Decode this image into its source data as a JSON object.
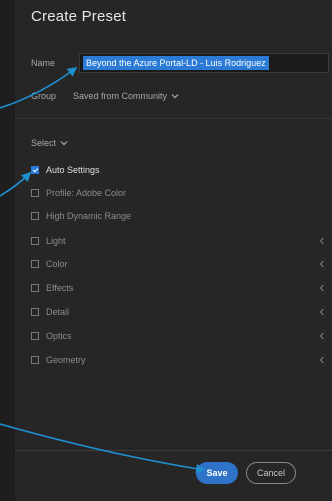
{
  "dialog": {
    "title": "Create Preset"
  },
  "name_field": {
    "label": "Name",
    "value": "Beyond the Azure Portal-LD - Luis Rodriguez"
  },
  "group_field": {
    "label": "Group",
    "value": "Saved from Community"
  },
  "select_menu": {
    "label": "Select"
  },
  "settings": [
    {
      "label": "Auto Settings",
      "checked": true,
      "expandable": false
    },
    {
      "label": "Profile: Adobe Color",
      "checked": false,
      "expandable": false
    },
    {
      "label": "High Dynamic Range",
      "checked": false,
      "expandable": false
    },
    {
      "label": "Light",
      "checked": false,
      "expandable": true
    },
    {
      "label": "Color",
      "checked": false,
      "expandable": true
    },
    {
      "label": "Effects",
      "checked": false,
      "expandable": true
    },
    {
      "label": "Detail",
      "checked": false,
      "expandable": true
    },
    {
      "label": "Optics",
      "checked": false,
      "expandable": true
    },
    {
      "label": "Geometry",
      "checked": false,
      "expandable": true
    }
  ],
  "buttons": {
    "save": "Save",
    "cancel": "Cancel"
  },
  "colors": {
    "accent": "#2a7ad6",
    "annotation_arrow": "#1f8fd0",
    "background": "#262626"
  },
  "icons": {
    "group_dropdown": "chevron-down-icon",
    "select_dropdown": "chevron-down-icon",
    "section_expander": "chevron-left-icon",
    "annotation": "arrow-icon"
  }
}
